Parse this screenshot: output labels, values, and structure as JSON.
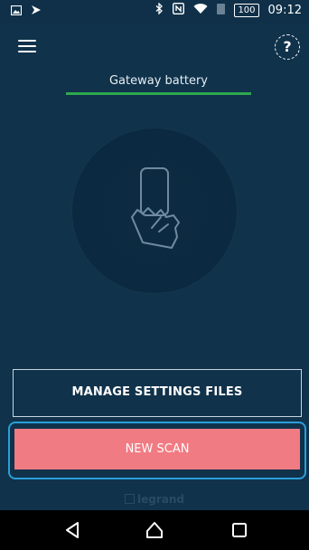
{
  "status_bar": {
    "battery_level": "100",
    "time": "09:12",
    "icons": [
      "image-icon",
      "vpn-icon",
      "bluetooth-icon",
      "nfc-icon",
      "wifi-icon",
      "sim-icon",
      "battery-icon"
    ]
  },
  "app_bar": {
    "menu_icon": "hamburger-menu-icon",
    "help_icon": "help-question-icon",
    "help_glyph": "?"
  },
  "gateway": {
    "label": "Gateway battery",
    "level": 1.0,
    "bar_color": "#2da84d"
  },
  "center_icon": "phone-in-hand-icon",
  "buttons": {
    "manage_label": "MANAGE SETTINGS FILES",
    "scan_label": "NEW SCAN",
    "scan_color": "#f17b83",
    "focus_color": "#2a9fd8"
  },
  "brand": {
    "logo_text": "legrand"
  },
  "nav_bar": {
    "back_icon": "back-triangle-icon",
    "home_icon": "home-circle-icon",
    "recents_icon": "recents-square-icon"
  },
  "colors": {
    "background": "#10324b",
    "accent_green": "#2da84d"
  }
}
